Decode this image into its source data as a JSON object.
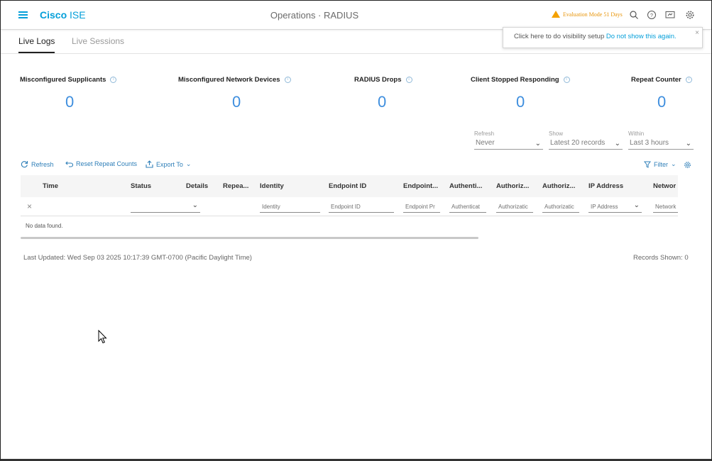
{
  "header": {
    "brand_bold": "Cisco",
    "brand_light": "ISE",
    "title": "Operations · RADIUS",
    "evaluation": "Evaluation Mode 51 Days"
  },
  "popover": {
    "text": "Click here to do visibility setup",
    "link": "Do not show this again.",
    "close": "×"
  },
  "tabs": [
    {
      "label": "Live Logs",
      "active": true
    },
    {
      "label": "Live Sessions",
      "active": false
    }
  ],
  "counters": [
    {
      "label": "Misconfigured Supplicants",
      "value": "0"
    },
    {
      "label": "Misconfigured Network Devices",
      "value": "0"
    },
    {
      "label": "RADIUS Drops",
      "value": "0"
    },
    {
      "label": "Client Stopped Responding",
      "value": "0"
    },
    {
      "label": "Repeat Counter",
      "value": "0"
    }
  ],
  "filters": {
    "refresh": {
      "label": "Refresh",
      "value": "Never"
    },
    "show": {
      "label": "Show",
      "value": "Latest 20 records"
    },
    "within": {
      "label": "Within",
      "value": "Last 3 hours"
    }
  },
  "toolbar": {
    "refresh": "Refresh",
    "reset": "Reset Repeat Counts",
    "export": "Export To",
    "filter": "Filter"
  },
  "table": {
    "columns": [
      "Time",
      "Status",
      "Details",
      "Repea...",
      "Identity",
      "Endpoint ID",
      "Endpoint...",
      "Authenti...",
      "Authoriz...",
      "Authoriz...",
      "IP Address",
      "Networ"
    ],
    "filter_placeholders": {
      "identity": "Identity",
      "endpoint_id": "Endpoint ID",
      "endpoint_profile": "Endpoint Pr",
      "authentication": "Authenticat",
      "authorization1": "Authorizatic",
      "authorization2": "Authorizatic",
      "ip_address": "IP Address",
      "network": "Network"
    },
    "empty": "No data found."
  },
  "footer": {
    "last_updated": "Last Updated: Wed Sep 03 2025 10:17:39 GMT-0700 (Pacific Daylight Time)",
    "records": "Records Shown: 0"
  },
  "colors": {
    "accent": "#049fd9",
    "counter_value": "#3e8ede",
    "warning": "#f4a100"
  }
}
